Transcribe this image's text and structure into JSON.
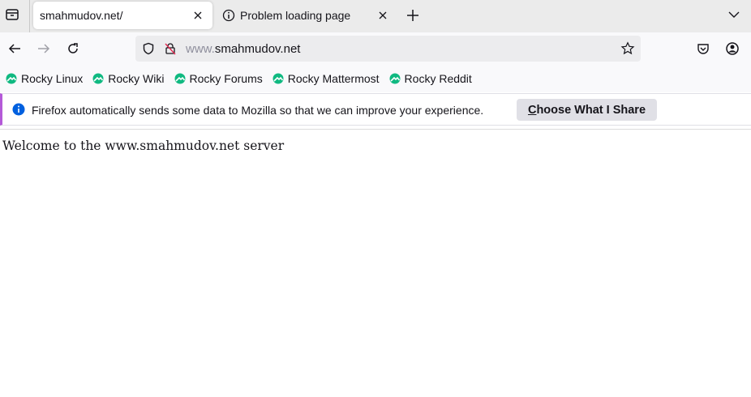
{
  "tabs": [
    {
      "title": "smahmudov.net/",
      "active": true
    },
    {
      "title": "Problem loading page",
      "active": false,
      "icon": "info-icon"
    }
  ],
  "urlbar": {
    "host_prefix": "www.",
    "host": "smahmudov.net"
  },
  "bookmarks": [
    {
      "label": "Rocky Linux"
    },
    {
      "label": "Rocky Wiki"
    },
    {
      "label": "Rocky Forums"
    },
    {
      "label": "Rocky Mattermost"
    },
    {
      "label": "Rocky Reddit"
    }
  ],
  "notification": {
    "message": "Firefox automatically sends some data to Mozilla so that we can improve your experience.",
    "button": "Choose What I Share",
    "accesskey": "C",
    "button_rest": "hoose What I Share"
  },
  "page": {
    "text": "Welcome to the www.smahmudov.net server"
  },
  "colors": {
    "accent": "#0060df",
    "rocky": "#10b981",
    "bar": "#ebebeb"
  }
}
